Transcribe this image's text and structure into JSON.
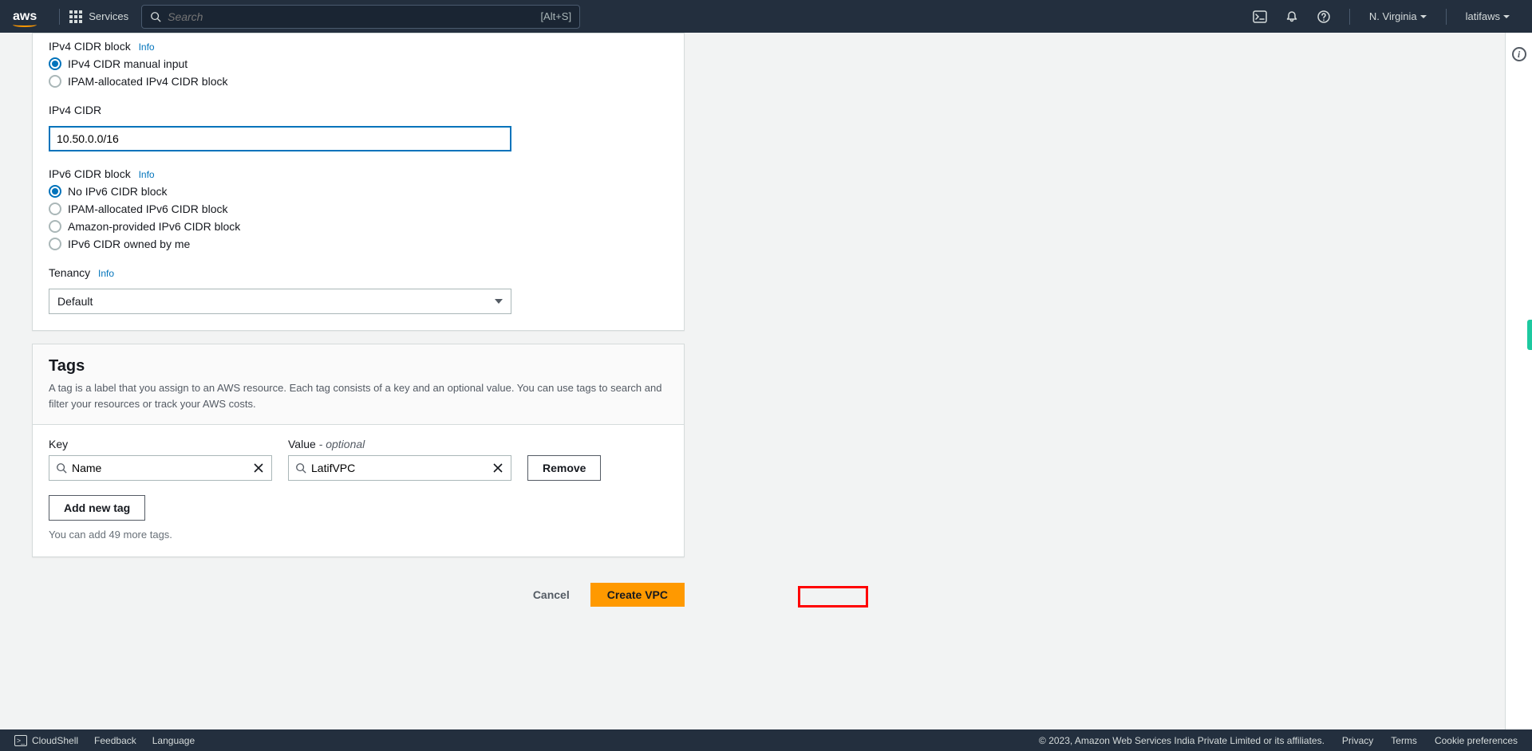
{
  "nav": {
    "logo": "aws",
    "services": "Services",
    "search_placeholder": "Search",
    "search_hint": "[Alt+S]",
    "region": "N. Virginia",
    "account": "latifaws"
  },
  "ipv4_block": {
    "label": "IPv4 CIDR block",
    "info": "Info",
    "options": [
      "IPv4 CIDR manual input",
      "IPAM-allocated IPv4 CIDR block"
    ],
    "selected": 0
  },
  "ipv4_cidr": {
    "label": "IPv4 CIDR",
    "value": "10.50.0.0/16"
  },
  "ipv6_block": {
    "label": "IPv6 CIDR block",
    "info": "Info",
    "options": [
      "No IPv6 CIDR block",
      "IPAM-allocated IPv6 CIDR block",
      "Amazon-provided IPv6 CIDR block",
      "IPv6 CIDR owned by me"
    ],
    "selected": 0
  },
  "tenancy": {
    "label": "Tenancy",
    "info": "Info",
    "value": "Default"
  },
  "tags": {
    "title": "Tags",
    "desc": "A tag is a label that you assign to an AWS resource. Each tag consists of a key and an optional value. You can use tags to search and filter your resources or track your AWS costs.",
    "key_label": "Key",
    "value_label_main": "Value",
    "value_label_opt": " - optional",
    "rows": [
      {
        "key": "Name",
        "value": "LatifVPC"
      }
    ],
    "remove": "Remove",
    "add_new": "Add new tag",
    "hint": "You can add 49 more tags."
  },
  "actions": {
    "cancel": "Cancel",
    "create": "Create VPC"
  },
  "footer": {
    "cloudshell": "CloudShell",
    "feedback": "Feedback",
    "language": "Language",
    "copyright": "© 2023, Amazon Web Services India Private Limited or its affiliates.",
    "privacy": "Privacy",
    "terms": "Terms",
    "cookie": "Cookie preferences"
  }
}
